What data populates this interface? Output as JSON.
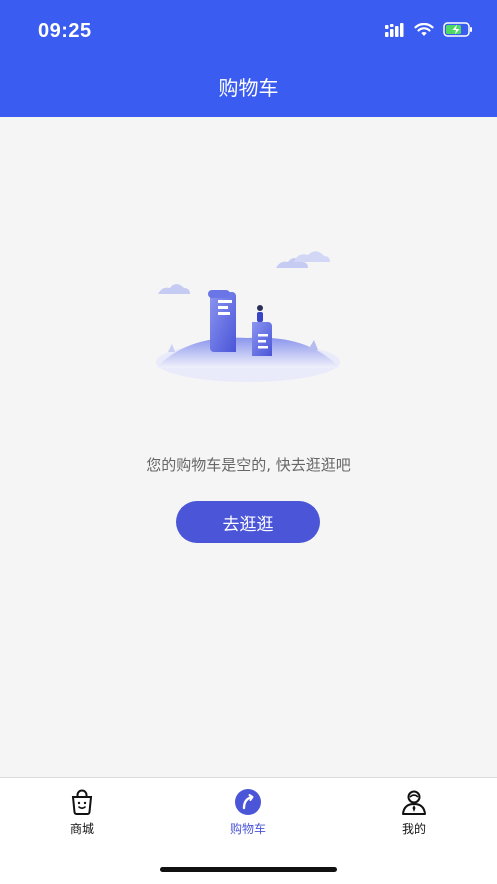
{
  "status_bar": {
    "time": "09:25"
  },
  "header": {
    "title": "购物车"
  },
  "empty_state": {
    "message": "您的购物车是空的, 快去逛逛吧",
    "button_label": "去逛逛"
  },
  "tabs": [
    {
      "label": "商城",
      "icon": "shopping-bag-icon"
    },
    {
      "label": "购物车",
      "icon": "cart-circle-icon"
    },
    {
      "label": "我的",
      "icon": "user-icon"
    }
  ],
  "colors": {
    "primary": "#3a5cf0",
    "button": "#4a55d8",
    "background": "#f5f5f5"
  }
}
